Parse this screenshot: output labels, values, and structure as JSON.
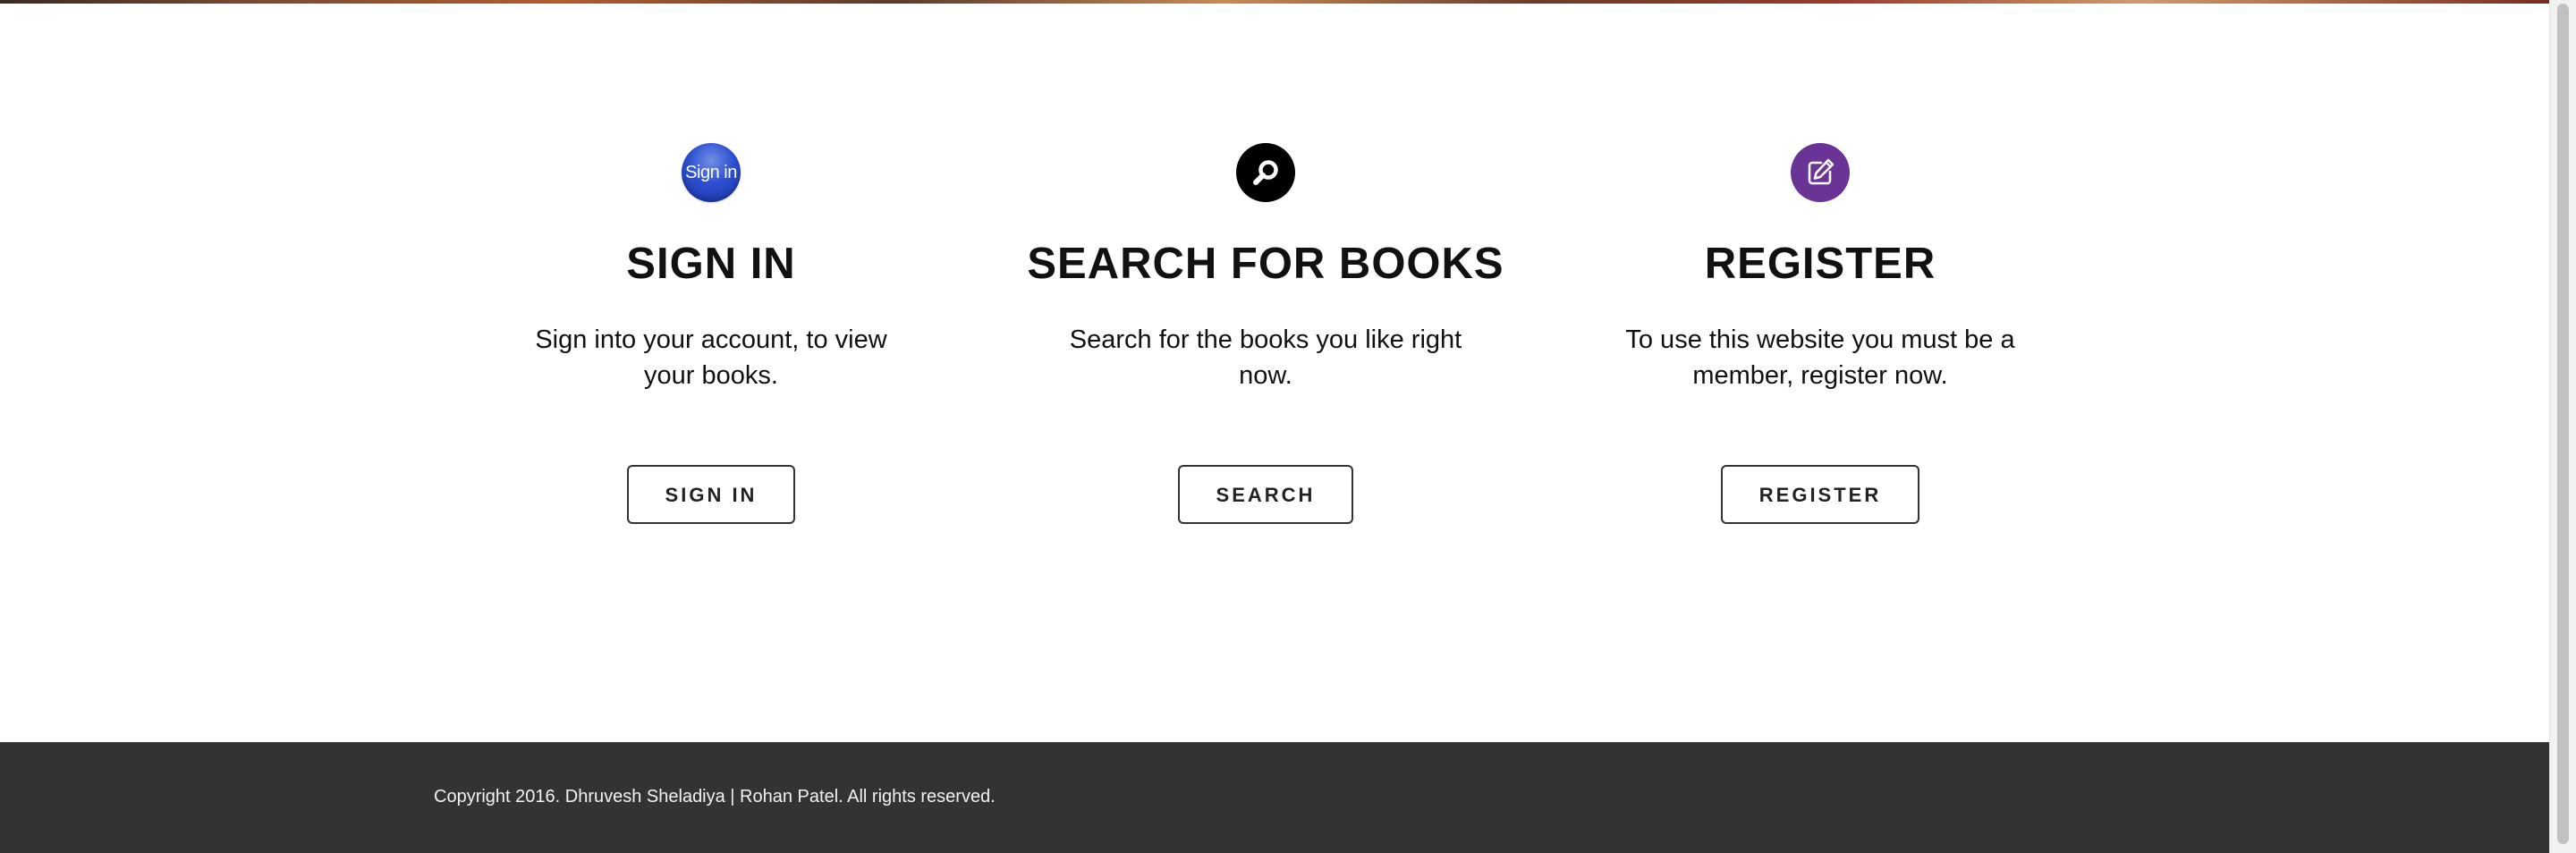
{
  "features": [
    {
      "icon": "sign-in-badge-icon",
      "icon_text": "Sign in",
      "title": "SIGN IN",
      "description": "Sign into your account, to view your books.",
      "button_label": "SIGN IN"
    },
    {
      "icon": "search-icon",
      "title": "SEARCH FOR BOOKS",
      "description": "Search for the books you like right now.",
      "button_label": "SEARCH"
    },
    {
      "icon": "edit-icon",
      "title": "REGISTER",
      "description": "To use this website you must be a member, register now.",
      "button_label": "REGISTER"
    }
  ],
  "footer": {
    "copyright": "Copyright 2016. Dhruvesh Sheladiya | Rohan Patel. All rights reserved."
  },
  "colors": {
    "sign_in_icon": "#2d4fd0",
    "search_icon": "#000000",
    "register_icon": "#6a3497",
    "footer_background": "#333333"
  }
}
